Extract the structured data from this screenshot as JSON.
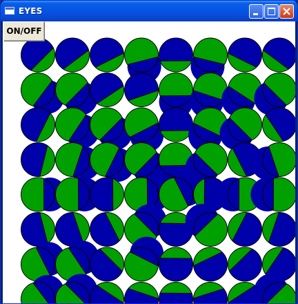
{
  "window": {
    "title": "EYES",
    "icon": "app-window-icon",
    "controls": [
      "minimize-icon",
      "maximize-icon",
      "close-icon"
    ]
  },
  "toolbar": {
    "toggle_label": "ON/OFF"
  },
  "eyes": {
    "rows": 8,
    "columns": 8,
    "colors": {
      "iris": "#0000aa",
      "white": "#00a000",
      "outline": "#000000"
    }
  }
}
